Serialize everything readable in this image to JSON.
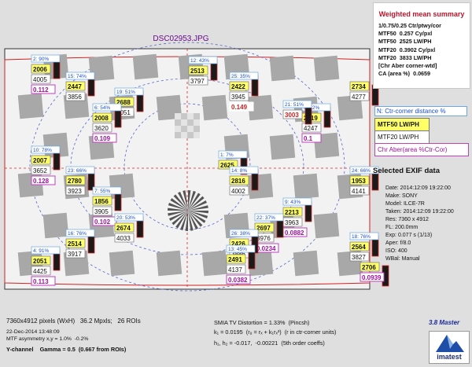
{
  "title": "DSC02953.JPG",
  "summary": {
    "heading": "Weighted mean summary",
    "lines": [
      "1/0.75/0.25 Ctr/ptwy/cor",
      "MTF50  0.257 Cy/pxl",
      "MTF50  2525 LW/PH",
      "MTF20  0.3902 Cy/pxl",
      "MTF20  3833 LW/PH",
      "[Chr Aber corner-wtd]",
      "CA (area %)  0.0659"
    ]
  },
  "legend": {
    "ctr_distance": "N:  Ctr-corner distance %",
    "mtf50": "MTF50  LW/PH",
    "mtf20": "MTF20  LW/PH",
    "chr_aber": "Chr Aber(area %Ctr-Cor)"
  },
  "exif": {
    "heading": "Selected EXIF data",
    "rows": [
      "Date:  2014:12:09 19:22:00",
      "Make:  SONY",
      "Model:  ILCE-7R",
      "Taken:  2014:12:09 19:22:00",
      "Res:  7360 x 4912",
      "FL:    200.0mm",
      "Exp:    0.077 s  (1/13)",
      "Aper:   f/8.0",
      "ISO:    400",
      "WBal:  Manual"
    ]
  },
  "bottom": {
    "pixels": "7360x4912 pixels (WxH)   36.2 Mpxls;   26 ROIs",
    "date": "22-Dec-2014 13:48:09",
    "asymmetry": "MTF asymmetry x,y = 1.0%  -0.2%",
    "channel": "Y-channel    Gamma = 0.5  (0.667 from ROIs)",
    "distortion": "SMIA TV Distortion = 1.33%  (Pincsh)",
    "k1": "k₁ = 0.0195  (rᵤ = rₓ + k₁rₓ³)  (r in ctr-corner units)",
    "h": "h₁, h₂ = -0.017,  -0.00221  (5th order coeffs)",
    "version": "3.8 Master",
    "brand": "imatest"
  },
  "rois": [
    {
      "pct": "2: 90%",
      "m50": "2006",
      "m20": "4005",
      "ca": "0.112"
    },
    {
      "pct": "15: 74%",
      "m50": "2447",
      "m20": "3856",
      "ca": ""
    },
    {
      "pct": "12: 43%",
      "m50": "2513",
      "m20": "3797",
      "ca": ""
    },
    {
      "pct": "25: 35%",
      "m50": "2422",
      "m20": "3945",
      "ca": "0.149"
    },
    {
      "pct": "19: 51%",
      "m50": "2688",
      "m20": "4051",
      "ca": ""
    },
    {
      "pct": "6: 54%",
      "m50": "2008",
      "m20": "3620",
      "ca": "0.109"
    },
    {
      "pct": "8: 42%",
      "m50": "2219",
      "m20": "4247",
      "ca": "0.1"
    },
    {
      "pct": "21: 51%",
      "m50": "3003",
      "m20": "",
      "ca": ""
    },
    {
      "pct": "",
      "m50": "2734",
      "m20": "4277",
      "ca": ""
    },
    {
      "pct": "10: 78%",
      "m50": "2007",
      "m20": "3652",
      "ca": "0.128"
    },
    {
      "pct": "23: 66%",
      "m50": "2780",
      "m20": "3923",
      "ca": ""
    },
    {
      "pct": "1: 7%",
      "m50": "2625",
      "m20": "",
      "ca": ""
    },
    {
      "pct": "14: 8%",
      "m50": "2816",
      "m20": "4002",
      "ca": ""
    },
    {
      "pct": "24: 66%",
      "m50": "1953",
      "m20": "4141",
      "ca": ""
    },
    {
      "pct": "7: 55%",
      "m50": "1856",
      "m20": "3905",
      "ca": "0.102"
    },
    {
      "pct": "20: 53%",
      "m50": "2674",
      "m20": "4033",
      "ca": ""
    },
    {
      "pct": "16: 76%",
      "m50": "2514",
      "m20": "3917",
      "ca": ""
    },
    {
      "pct": "9: 43%",
      "m50": "2213",
      "m20": "3963",
      "ca": "0.0882"
    },
    {
      "pct": "22: 37%",
      "m50": "2697",
      "m20": "3976",
      "ca": "0.0234"
    },
    {
      "pct": "26: 38%",
      "m50": "2426",
      "m20": "3886",
      "ca": ""
    },
    {
      "pct": "13: 45%",
      "m50": "2491",
      "m20": "4137",
      "ca": "0.0382"
    },
    {
      "pct": "4: 91%",
      "m50": "2051",
      "m20": "4425",
      "ca": "0.113"
    },
    {
      "pct": "18: 76%",
      "m50": "2564",
      "m20": "3827",
      "ca": ""
    },
    {
      "pct": "",
      "m50": "2706",
      "m20": "",
      "ca": "0.0939"
    }
  ]
}
